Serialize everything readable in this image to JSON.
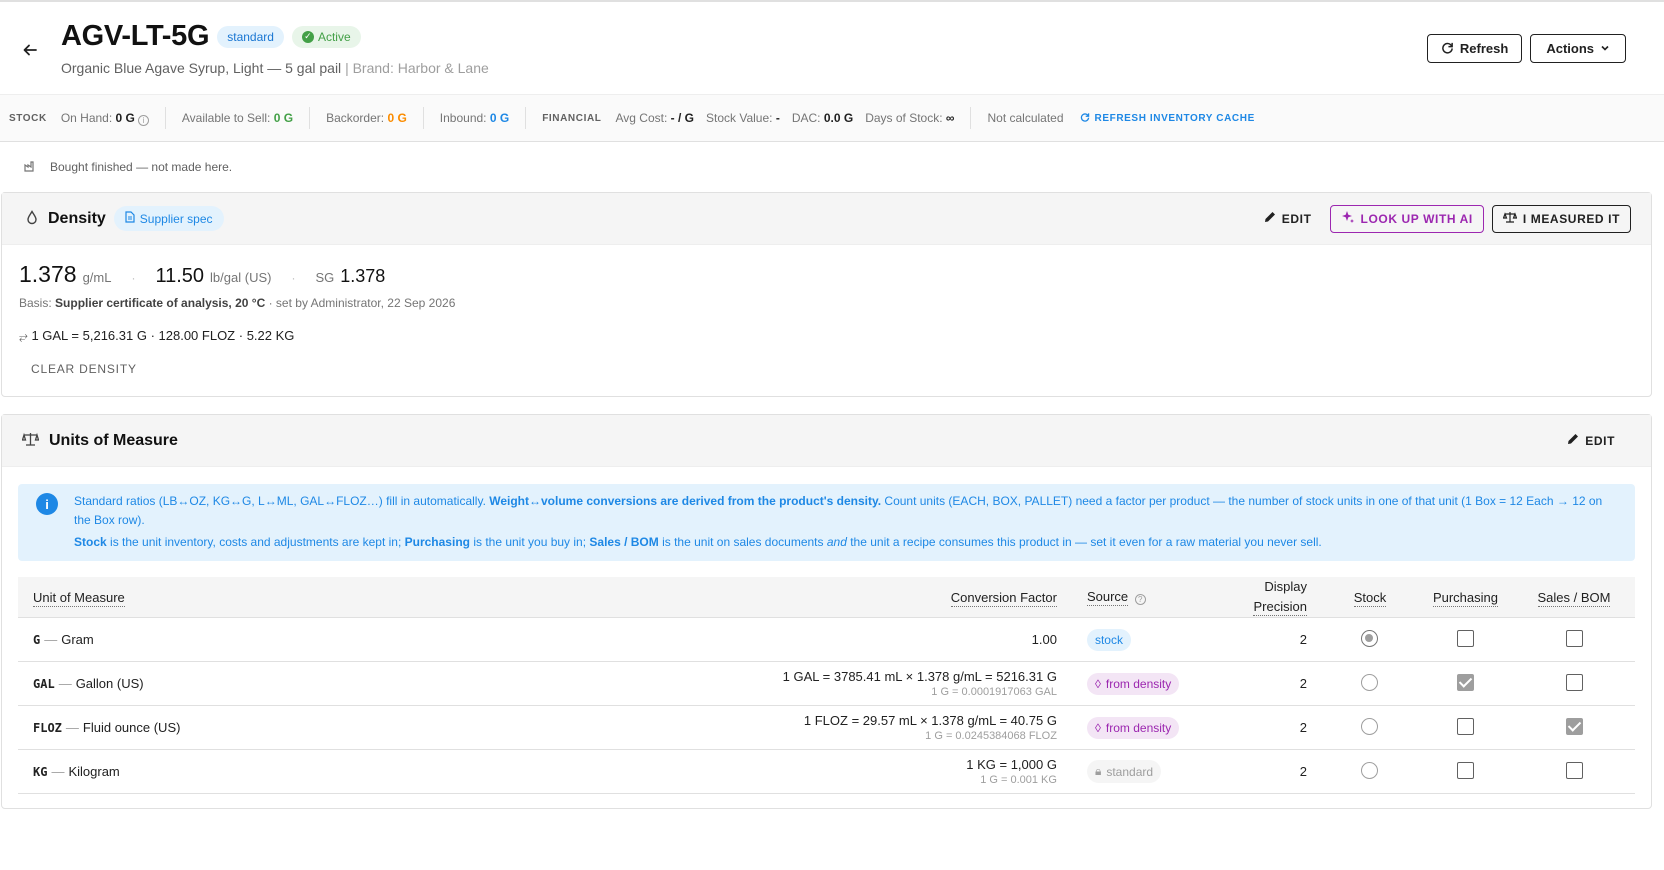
{
  "header": {
    "sku": "AGV-LT-5G",
    "type_chip": "standard",
    "status_chip": "Active",
    "description": "Organic Blue Agave Syrup, Light — 5 gal pail",
    "brand": "| Brand: Harbor & Lane",
    "refresh_label": "Refresh",
    "actions_label": "Actions"
  },
  "stats": {
    "stock_label": "STOCK",
    "on_hand_label": "On Hand:",
    "on_hand": "0 G",
    "available_label": "Available to Sell:",
    "available": "0 G",
    "backorder_label": "Backorder:",
    "backorder": "0 G",
    "inbound_label": "Inbound:",
    "inbound": "0 G",
    "financial_label": "FINANCIAL",
    "avg_cost_label": "Avg Cost:",
    "avg_cost": "- / G",
    "stock_value_label": "Stock Value:",
    "stock_value": "-",
    "dac_label": "DAC:",
    "dac": "0.0 G",
    "days_label": "Days of Stock:",
    "days": "∞",
    "not_calculated": "Not calculated",
    "refresh_cache": "REFRESH INVENTORY CACHE"
  },
  "bought_note": "Bought finished — not made here.",
  "density": {
    "title": "Density",
    "source_chip": "Supplier spec",
    "edit": "EDIT",
    "lookup": "LOOK UP WITH AI",
    "measured": "I MEASURED IT",
    "g_ml": "1.378",
    "g_ml_unit": "g/mL",
    "lb_gal": "11.50",
    "lb_gal_unit": "lb/gal (US)",
    "sg_label": "SG",
    "sg": "1.378",
    "basis_prefix": "Basis:",
    "basis_value": "Supplier certificate of analysis, 20 °C",
    "basis_suffix": "· set by Administrator, 22 Sep 2026",
    "conv_gal": "1 GAL = 5,216.31 G",
    "conv_floz": "· 128.00 FLOZ",
    "conv_kg": "· 5.22 KG",
    "clear": "CLEAR DENSITY"
  },
  "uom": {
    "title": "Units of Measure",
    "edit": "EDIT",
    "alert_1a": "Standard ratios (LB↔OZ, KG↔G, L↔ML, GAL↔FLOZ…) fill in automatically. ",
    "alert_1b": "Weight↔volume conversions are derived from the product's density.",
    "alert_1c": " Count units (EACH, BOX, PALLET) need a factor per product — the number of stock units in one of that unit (1 Box = 12 Each → 12 on the Box row).",
    "alert_2a": "Stock",
    "alert_2b": " is the unit inventory, costs and adjustments are kept in; ",
    "alert_2c": "Purchasing",
    "alert_2d": " is the unit you buy in; ",
    "alert_2e": "Sales / BOM",
    "alert_2f": " is the unit on sales documents ",
    "alert_2g": "and",
    "alert_2h": " the unit a recipe consumes this product in — set it even for a raw material you never sell.",
    "columns": {
      "uom": "Unit of Measure",
      "factor": "Conversion Factor",
      "source": "Source",
      "precision_1": "Display",
      "precision_2": "Precision",
      "stock": "Stock",
      "purchasing": "Purchasing",
      "sales": "Sales / BOM"
    },
    "rows": [
      {
        "code": "G",
        "name": "Gram",
        "factor": "1.00",
        "factor_sub": "",
        "source": "stock",
        "precision": "2"
      },
      {
        "code": "GAL",
        "name": "Gallon (US)",
        "factor": "1 GAL = 3785.41 mL × 1.378 g/mL = 5216.31 G",
        "factor_sub": "1 G = 0.0001917063 GAL",
        "source": "from density",
        "precision": "2"
      },
      {
        "code": "FLOZ",
        "name": "Fluid ounce (US)",
        "factor": "1 FLOZ = 29.57 mL × 1.378 g/mL = 40.75 G",
        "factor_sub": "1 G = 0.0245384068 FLOZ",
        "source": "from density",
        "precision": "2"
      },
      {
        "code": "KG",
        "name": "Kilogram",
        "factor": "1 KG = 1,000 G",
        "factor_sub": "1 G = 0.001 KG",
        "source": "standard",
        "precision": "2"
      }
    ]
  }
}
